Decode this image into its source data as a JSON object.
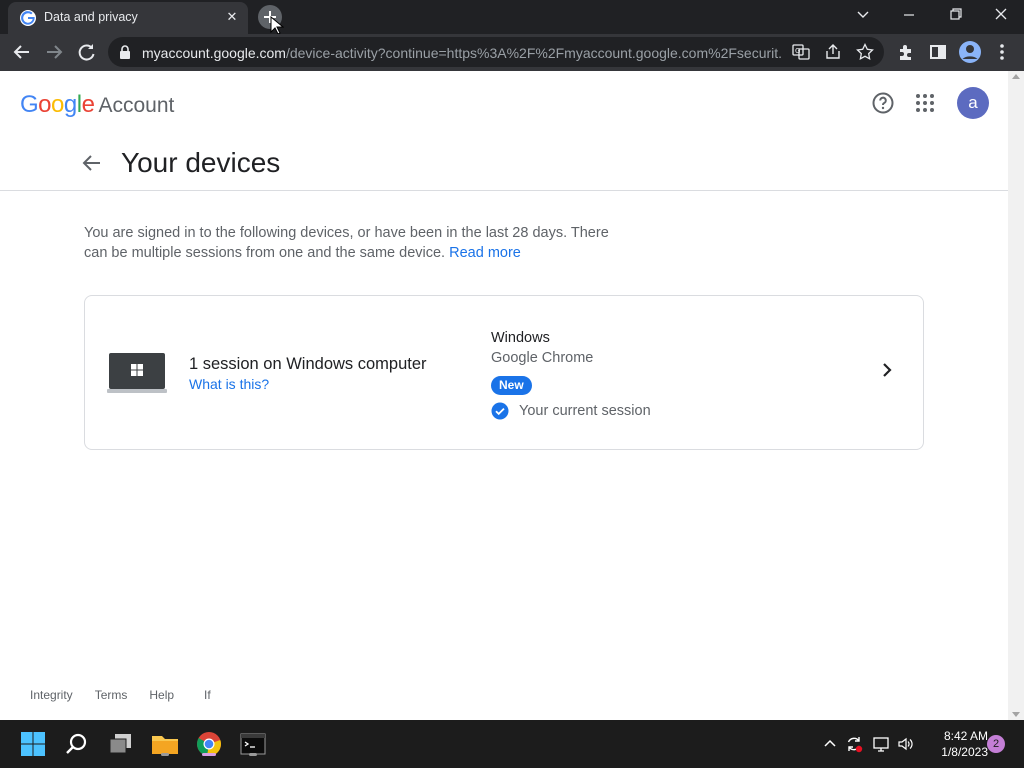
{
  "browser": {
    "tab_title": "Data and privacy",
    "url_host": "myaccount.google.com",
    "url_path": "/device-activity?continue=https%3A%2F%2Fmyaccount.google.com%2Fsecurit..."
  },
  "header": {
    "logo_word": "Google",
    "logo_suffix": "Account",
    "avatar_letter": "a"
  },
  "page": {
    "title": "Your devices",
    "intro": "You are signed in to the following devices, or have been in the last 28 days. There can be multiple sessions from one and the same device.",
    "read_more": "Read more"
  },
  "device_card": {
    "session_title": "1 session on Windows computer",
    "what_is_this": "What is this?",
    "os": "Windows",
    "browser": "Google Chrome",
    "badge": "New",
    "current_session": "Your current session"
  },
  "footer": {
    "links": [
      "Integrity",
      "Terms",
      "Help",
      "If"
    ]
  },
  "taskbar": {
    "time": "8:42 AM",
    "date": "1/8/2023",
    "notifications": "2"
  },
  "colors": {
    "accent": "#1a73e8",
    "avatar_bg": "#5c6bc0",
    "google_blue": "#4285f4",
    "google_red": "#ea4335",
    "google_yellow": "#fbbc05",
    "google_green": "#34a853"
  }
}
